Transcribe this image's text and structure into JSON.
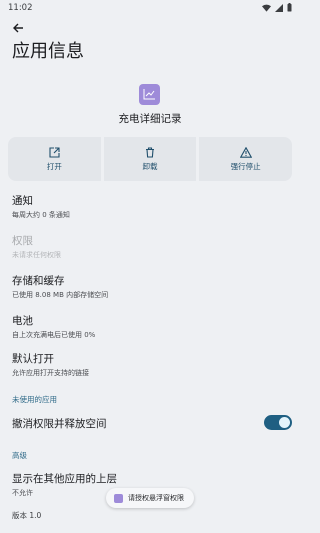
{
  "status_bar": {
    "time": "11:02"
  },
  "page": {
    "title": "应用信息"
  },
  "app": {
    "name": "充电详细记录"
  },
  "actions": [
    {
      "label": "打开",
      "icon": "open-external-icon"
    },
    {
      "label": "卸载",
      "icon": "trash-icon"
    },
    {
      "label": "强行停止",
      "icon": "warning-icon"
    }
  ],
  "settings": {
    "notifications": {
      "title": "通知",
      "subtitle": "每周大约 0 条通知"
    },
    "permissions": {
      "title": "权限",
      "subtitle": "未请求任何权限"
    },
    "storage": {
      "title": "存储和缓存",
      "subtitle": "已使用 8.08 MB 内部存储空间"
    },
    "battery": {
      "title": "电池",
      "subtitle": "自上次充满电后已使用 0%"
    },
    "open_by_default": {
      "title": "默认打开",
      "subtitle": "允许应用打开支持的链接"
    }
  },
  "unused_apps": {
    "header": "未使用的应用",
    "revoke": {
      "title": "撤消权限并释放空间",
      "enabled": true
    }
  },
  "advanced": {
    "header": "高级",
    "overlay": {
      "title": "显示在其他应用的上层",
      "subtitle": "不允许"
    }
  },
  "version": "版本 1.0",
  "toast": {
    "text": "请授权悬浮窗权限"
  },
  "colors": {
    "accent": "#1f5f82",
    "app_icon": "#9e8bd9",
    "background": "#eef0f3"
  }
}
